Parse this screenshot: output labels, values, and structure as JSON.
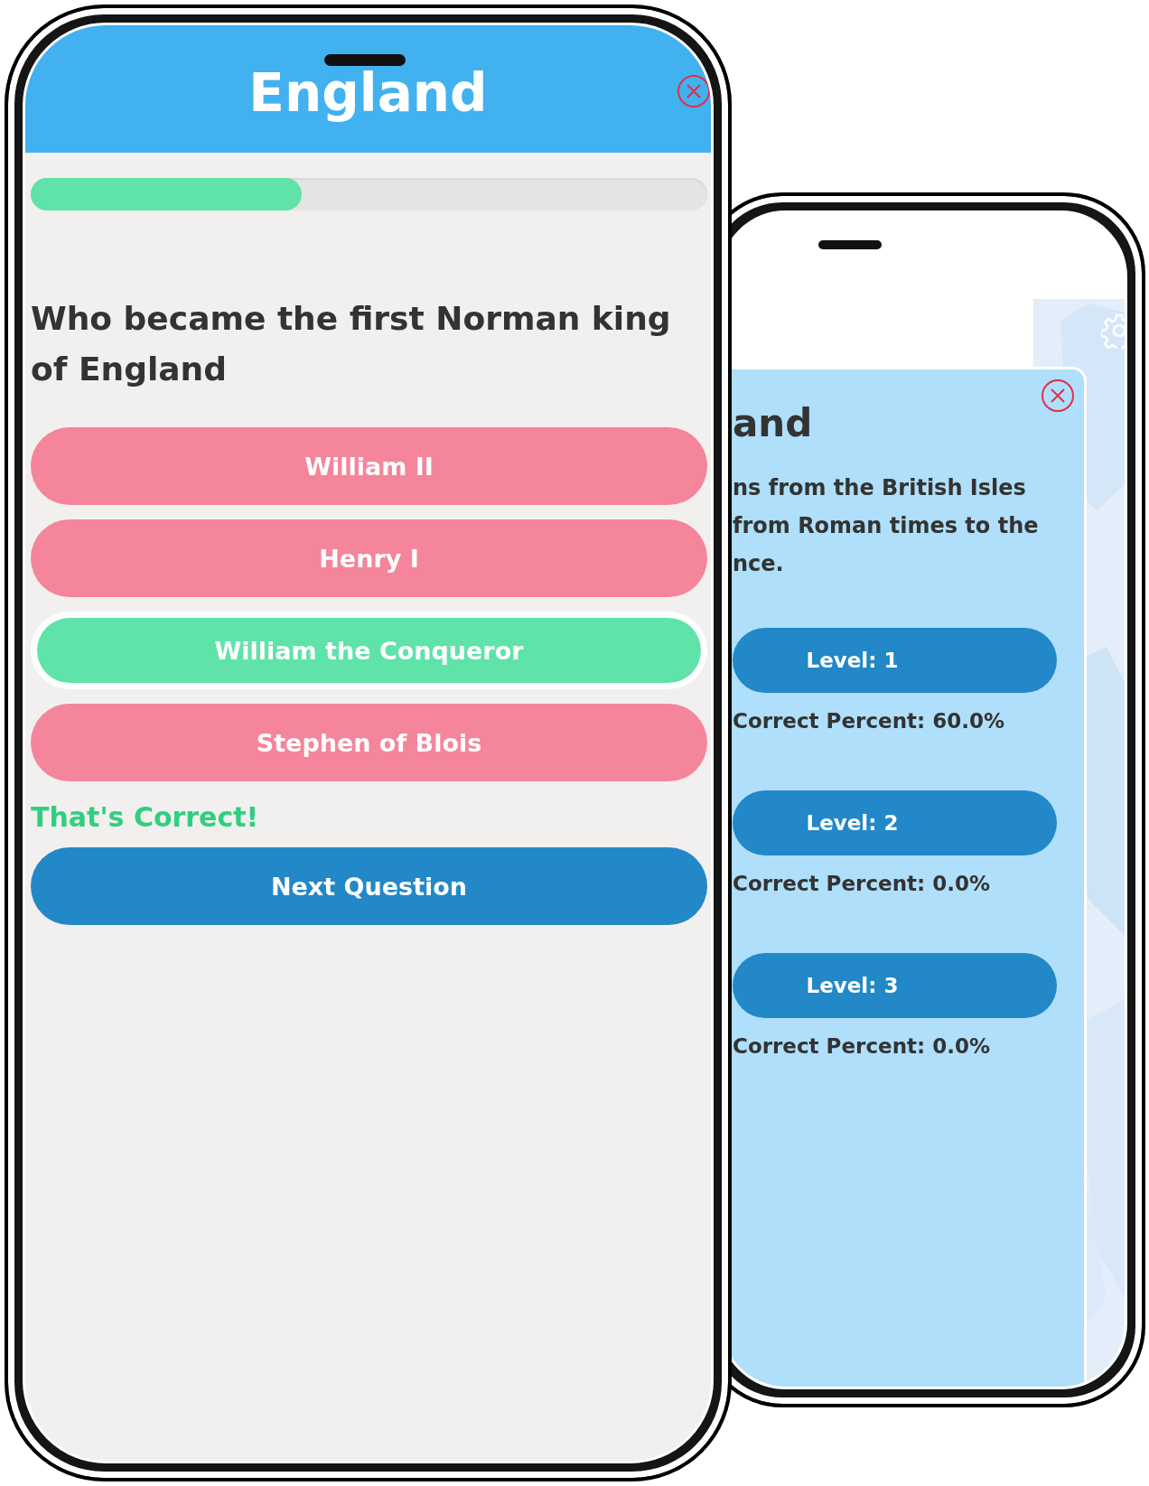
{
  "quiz": {
    "title": "England",
    "progress": {
      "level": 0.4
    },
    "question": "Who became the first Norman king of England",
    "answers": [
      {
        "label": "William II",
        "correct": false
      },
      {
        "label": "Henry I",
        "correct": false
      },
      {
        "label": "William the Conqueror",
        "correct": true
      },
      {
        "label": "Stephen of Blois",
        "correct": false
      }
    ],
    "feedback": "That's Correct!",
    "next_button": "Next Question"
  },
  "levels_screen": {
    "title": "and",
    "description_lines": [
      "ns from the British Isles",
      "from Roman times to the",
      "nce."
    ],
    "levels": [
      {
        "button": "Level: 1",
        "stats": "Correct Percent: 60.0%"
      },
      {
        "button": "Level: 2",
        "stats": "Correct Percent: 0.0%"
      },
      {
        "button": "Level: 3",
        "stats": "Correct Percent: 0.0%"
      }
    ]
  }
}
